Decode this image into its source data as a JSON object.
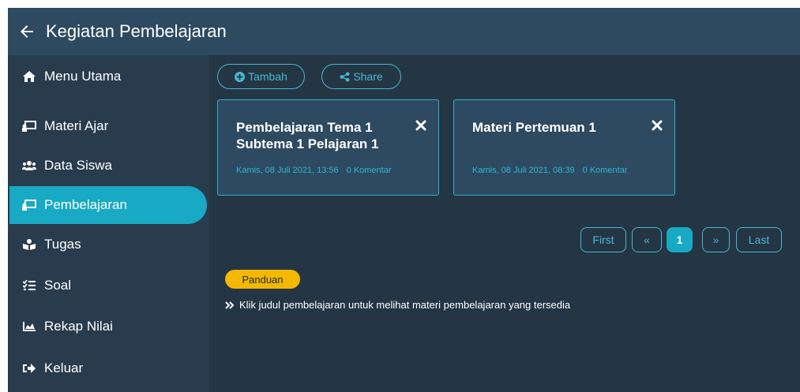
{
  "header": {
    "title": "Kegiatan Pembelajaran"
  },
  "sidebar": {
    "items": [
      {
        "label": "Menu Utama",
        "icon": "home-icon"
      },
      {
        "label": "Materi Ajar",
        "icon": "chalkboard-icon"
      },
      {
        "label": "Data Siswa",
        "icon": "users-icon"
      },
      {
        "label": "Pembelajaran",
        "icon": "chalkboard-icon",
        "active": true
      },
      {
        "label": "Tugas",
        "icon": "book-reader-icon"
      },
      {
        "label": "Soal",
        "icon": "list-check-icon"
      },
      {
        "label": "Rekap Nilai",
        "icon": "chart-area-icon"
      },
      {
        "label": "Keluar",
        "icon": "sign-out-icon"
      }
    ]
  },
  "toolbar": {
    "add_label": "Tambah",
    "share_label": "Share"
  },
  "cards": [
    {
      "title": "Pembelajaran Tema 1 Subtema 1 Pelajaran 1",
      "date": "Kamis, 08 Juli 2021, 13:56",
      "comments": "0 Komentar"
    },
    {
      "title": "Materi Pertemuan 1",
      "date": "Kamis, 08 Juli 2021, 08:39",
      "comments": "0 Komentar"
    }
  ],
  "pagination": {
    "first": "First",
    "prev": "«",
    "current": "1",
    "next": "»",
    "last": "Last"
  },
  "guide": {
    "badge": "Panduan",
    "text": "Klik judul pembelajaran untuk melihat materi pembelajaran yang tersedia"
  },
  "colors": {
    "accent": "#18a9c4",
    "badge": "#f5b800",
    "background": "#243544",
    "sidebar": "#283c4e",
    "card": "#2e4a60"
  }
}
